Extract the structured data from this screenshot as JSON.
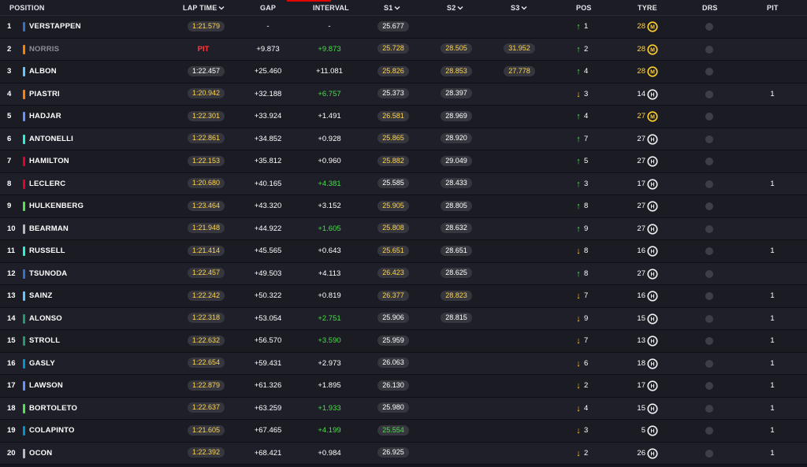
{
  "header": {
    "position": "POSITION",
    "lap_time": "LAP TIME",
    "gap": "GAP",
    "interval": "INTERVAL",
    "s1": "S1",
    "s2": "S2",
    "s3": "S3",
    "pos": "POS",
    "tyre": "TYRE",
    "drs": "DRS",
    "pit": "PIT"
  },
  "colors": {
    "background": "#15151e",
    "pill": "#36363f",
    "green": "#4cdd4a",
    "yellow": "#ffd54a",
    "red": "#ff3b3b",
    "accent": "#e10600"
  },
  "rows": [
    {
      "pos": "1",
      "driver": "VERSTAPPEN",
      "team_color": "#3671c6",
      "lap": "1:21.579",
      "lap_color": "yellow",
      "gap": "-",
      "interval": "-",
      "interval_color": "white",
      "s1": "25.677",
      "s1_color": "white",
      "s2": "",
      "s2_color": "white",
      "s3": "",
      "s3_color": "white",
      "dir": "up",
      "change": "1",
      "laps": "28",
      "laps_color": "yellow",
      "tyre": "M",
      "pit": ""
    },
    {
      "pos": "2",
      "driver": "NORRIS",
      "team_color": "#ff8000",
      "dim": true,
      "lap": "PIT",
      "lap_color": "pit",
      "gap": "+9.873",
      "interval": "+9.873",
      "interval_color": "green",
      "s1": "25.728",
      "s1_color": "yellow",
      "s2": "28.505",
      "s2_color": "yellow",
      "s3": "31.952",
      "s3_color": "yellow",
      "dir": "up",
      "change": "2",
      "laps": "28",
      "laps_color": "yellow",
      "tyre": "M",
      "pit": ""
    },
    {
      "pos": "3",
      "driver": "ALBON",
      "team_color": "#64c4ff",
      "lap": "1:22.457",
      "lap_color": "white",
      "gap": "+25.460",
      "interval": "+11.081",
      "interval_color": "white",
      "s1": "25.826",
      "s1_color": "yellow",
      "s2": "28.853",
      "s2_color": "yellow",
      "s3": "27.778",
      "s3_color": "yellow",
      "dir": "up",
      "change": "4",
      "laps": "28",
      "laps_color": "yellow",
      "tyre": "M",
      "pit": ""
    },
    {
      "pos": "4",
      "driver": "PIASTRI",
      "team_color": "#ff8000",
      "lap": "1:20.942",
      "lap_color": "yellow",
      "gap": "+32.188",
      "interval": "+6.757",
      "interval_color": "green",
      "s1": "25.373",
      "s1_color": "white",
      "s2": "28.397",
      "s2_color": "white",
      "s3": "",
      "s3_color": "white",
      "dir": "down",
      "change": "3",
      "laps": "14",
      "laps_color": "white",
      "tyre": "H",
      "pit": "1"
    },
    {
      "pos": "5",
      "driver": "HADJAR",
      "team_color": "#6692ff",
      "lap": "1:22.301",
      "lap_color": "yellow",
      "gap": "+33.924",
      "interval": "+1.491",
      "interval_color": "white",
      "s1": "26.581",
      "s1_color": "yellow",
      "s2": "28.969",
      "s2_color": "white",
      "s3": "",
      "s3_color": "white",
      "dir": "up",
      "change": "4",
      "laps": "27",
      "laps_color": "yellow",
      "tyre": "M",
      "pit": ""
    },
    {
      "pos": "6",
      "driver": "ANTONELLI",
      "team_color": "#27f4d2",
      "lap": "1:22.861",
      "lap_color": "yellow",
      "gap": "+34.852",
      "interval": "+0.928",
      "interval_color": "white",
      "s1": "25.865",
      "s1_color": "yellow",
      "s2": "28.920",
      "s2_color": "white",
      "s3": "",
      "s3_color": "white",
      "dir": "up",
      "change": "7",
      "laps": "27",
      "laps_color": "white",
      "tyre": "H",
      "pit": ""
    },
    {
      "pos": "7",
      "driver": "HAMILTON",
      "team_color": "#e8002d",
      "lap": "1:22.153",
      "lap_color": "yellow",
      "gap": "+35.812",
      "interval": "+0.960",
      "interval_color": "white",
      "s1": "25.882",
      "s1_color": "yellow",
      "s2": "29.049",
      "s2_color": "white",
      "s3": "",
      "s3_color": "white",
      "dir": "up",
      "change": "5",
      "laps": "27",
      "laps_color": "white",
      "tyre": "H",
      "pit": ""
    },
    {
      "pos": "8",
      "driver": "LECLERC",
      "team_color": "#e8002d",
      "lap": "1:20.680",
      "lap_color": "yellow",
      "gap": "+40.165",
      "interval": "+4.381",
      "interval_color": "green",
      "s1": "25.585",
      "s1_color": "white",
      "s2": "28.433",
      "s2_color": "white",
      "s3": "",
      "s3_color": "white",
      "dir": "up",
      "change": "3",
      "laps": "17",
      "laps_color": "white",
      "tyre": "H",
      "pit": "1"
    },
    {
      "pos": "9",
      "driver": "HULKENBERG",
      "team_color": "#52e252",
      "lap": "1:23.464",
      "lap_color": "yellow",
      "gap": "+43.320",
      "interval": "+3.152",
      "interval_color": "white",
      "s1": "25.905",
      "s1_color": "yellow",
      "s2": "28.805",
      "s2_color": "white",
      "s3": "",
      "s3_color": "white",
      "dir": "up",
      "change": "8",
      "laps": "27",
      "laps_color": "white",
      "tyre": "H",
      "pit": ""
    },
    {
      "pos": "10",
      "driver": "BEARMAN",
      "team_color": "#b6babd",
      "lap": "1:21.948",
      "lap_color": "yellow",
      "gap": "+44.922",
      "interval": "+1.605",
      "interval_color": "green",
      "s1": "25.808",
      "s1_color": "yellow",
      "s2": "28.632",
      "s2_color": "white",
      "s3": "",
      "s3_color": "white",
      "dir": "up",
      "change": "9",
      "laps": "27",
      "laps_color": "white",
      "tyre": "H",
      "pit": ""
    },
    {
      "pos": "11",
      "driver": "RUSSELL",
      "team_color": "#27f4d2",
      "lap": "1:21.414",
      "lap_color": "yellow",
      "gap": "+45.565",
      "interval": "+0.643",
      "interval_color": "white",
      "s1": "25.651",
      "s1_color": "yellow",
      "s2": "28.651",
      "s2_color": "white",
      "s3": "",
      "s3_color": "white",
      "dir": "down",
      "change": "8",
      "laps": "16",
      "laps_color": "white",
      "tyre": "H",
      "pit": "1"
    },
    {
      "pos": "12",
      "driver": "TSUNODA",
      "team_color": "#3671c6",
      "lap": "1:22.457",
      "lap_color": "yellow",
      "gap": "+49.503",
      "interval": "+4.113",
      "interval_color": "white",
      "s1": "26.423",
      "s1_color": "yellow",
      "s2": "28.625",
      "s2_color": "white",
      "s3": "",
      "s3_color": "white",
      "dir": "up",
      "change": "8",
      "laps": "27",
      "laps_color": "white",
      "tyre": "H",
      "pit": ""
    },
    {
      "pos": "13",
      "driver": "SAINZ",
      "team_color": "#64c4ff",
      "lap": "1:22.242",
      "lap_color": "yellow",
      "gap": "+50.322",
      "interval": "+0.819",
      "interval_color": "white",
      "s1": "26.377",
      "s1_color": "yellow",
      "s2": "28.823",
      "s2_color": "yellow",
      "s3": "",
      "s3_color": "white",
      "dir": "down",
      "change": "7",
      "laps": "16",
      "laps_color": "white",
      "tyre": "H",
      "pit": "1"
    },
    {
      "pos": "14",
      "driver": "ALONSO",
      "team_color": "#229971",
      "lap": "1:22.318",
      "lap_color": "yellow",
      "gap": "+53.054",
      "interval": "+2.751",
      "interval_color": "green",
      "s1": "25.906",
      "s1_color": "white",
      "s2": "28.815",
      "s2_color": "white",
      "s3": "",
      "s3_color": "white",
      "dir": "down",
      "change": "9",
      "laps": "15",
      "laps_color": "white",
      "tyre": "H",
      "pit": "1"
    },
    {
      "pos": "15",
      "driver": "STROLL",
      "team_color": "#229971",
      "lap": "1:22.632",
      "lap_color": "yellow",
      "gap": "+56.570",
      "interval": "+3.590",
      "interval_color": "green",
      "s1": "25.959",
      "s1_color": "white",
      "s2": "",
      "s2_color": "white",
      "s3": "",
      "s3_color": "white",
      "dir": "down",
      "change": "7",
      "laps": "13",
      "laps_color": "white",
      "tyre": "H",
      "pit": "1"
    },
    {
      "pos": "16",
      "driver": "GASLY",
      "team_color": "#0093cc",
      "lap": "1:22.654",
      "lap_color": "yellow",
      "gap": "+59.431",
      "interval": "+2.973",
      "interval_color": "white",
      "s1": "26.063",
      "s1_color": "white",
      "s2": "",
      "s2_color": "white",
      "s3": "",
      "s3_color": "white",
      "dir": "down",
      "change": "6",
      "laps": "18",
      "laps_color": "white",
      "tyre": "H",
      "pit": "1"
    },
    {
      "pos": "17",
      "driver": "LAWSON",
      "team_color": "#6692ff",
      "lap": "1:22.879",
      "lap_color": "yellow",
      "gap": "+61.326",
      "interval": "+1.895",
      "interval_color": "white",
      "s1": "26.130",
      "s1_color": "white",
      "s2": "",
      "s2_color": "white",
      "s3": "",
      "s3_color": "white",
      "dir": "down",
      "change": "2",
      "laps": "17",
      "laps_color": "white",
      "tyre": "H",
      "pit": "1"
    },
    {
      "pos": "18",
      "driver": "BORTOLETO",
      "team_color": "#52e252",
      "lap": "1:22.637",
      "lap_color": "yellow",
      "gap": "+63.259",
      "interval": "+1.933",
      "interval_color": "green",
      "s1": "25.980",
      "s1_color": "white",
      "s2": "",
      "s2_color": "white",
      "s3": "",
      "s3_color": "white",
      "dir": "down",
      "change": "4",
      "laps": "15",
      "laps_color": "white",
      "tyre": "H",
      "pit": "1"
    },
    {
      "pos": "19",
      "driver": "COLAPINTO",
      "team_color": "#0093cc",
      "lap": "1:21.605",
      "lap_color": "yellow",
      "gap": "+67.465",
      "interval": "+4.199",
      "interval_color": "green",
      "s1": "25.554",
      "s1_color": "green",
      "s2": "",
      "s2_color": "white",
      "s3": "",
      "s3_color": "white",
      "dir": "down",
      "change": "3",
      "laps": "5",
      "laps_color": "white",
      "tyre": "H",
      "pit": "1"
    },
    {
      "pos": "20",
      "driver": "OCON",
      "team_color": "#b6babd",
      "lap": "1:22.392",
      "lap_color": "yellow",
      "gap": "+68.421",
      "interval": "+0.984",
      "interval_color": "white",
      "s1": "26.925",
      "s1_color": "white",
      "s2": "",
      "s2_color": "white",
      "s3": "",
      "s3_color": "white",
      "dir": "down",
      "change": "2",
      "laps": "26",
      "laps_color": "white",
      "tyre": "H",
      "pit": "1"
    }
  ]
}
